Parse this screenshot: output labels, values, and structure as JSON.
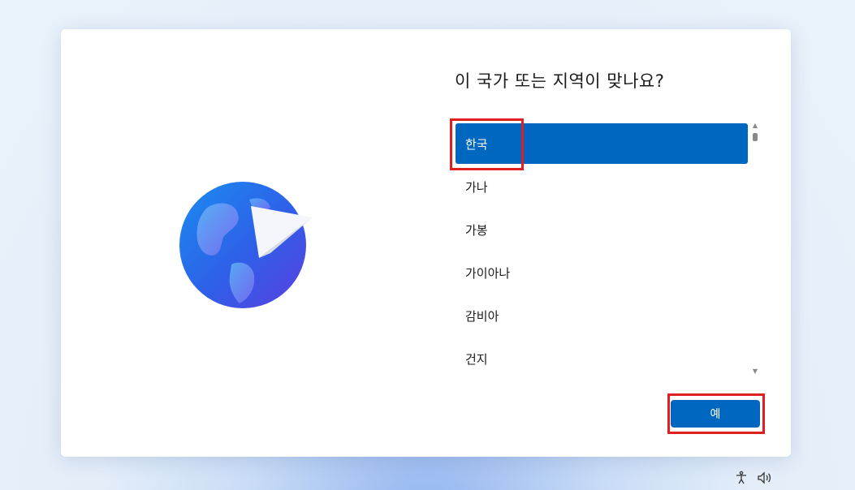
{
  "dialog": {
    "title": "이 국가 또는 지역이 맞나요?",
    "countries": [
      {
        "label": "한국",
        "selected": true
      },
      {
        "label": "가나",
        "selected": false
      },
      {
        "label": "가봉",
        "selected": false
      },
      {
        "label": "가이아나",
        "selected": false
      },
      {
        "label": "감비아",
        "selected": false
      },
      {
        "label": "건지",
        "selected": false
      }
    ],
    "yes_label": "예"
  },
  "taskbar": {
    "icons": [
      "accessibility-icon",
      "volume-icon"
    ]
  },
  "colors": {
    "accent": "#0067c0",
    "highlight_box": "#e02020",
    "card_background": "#ffffff"
  }
}
